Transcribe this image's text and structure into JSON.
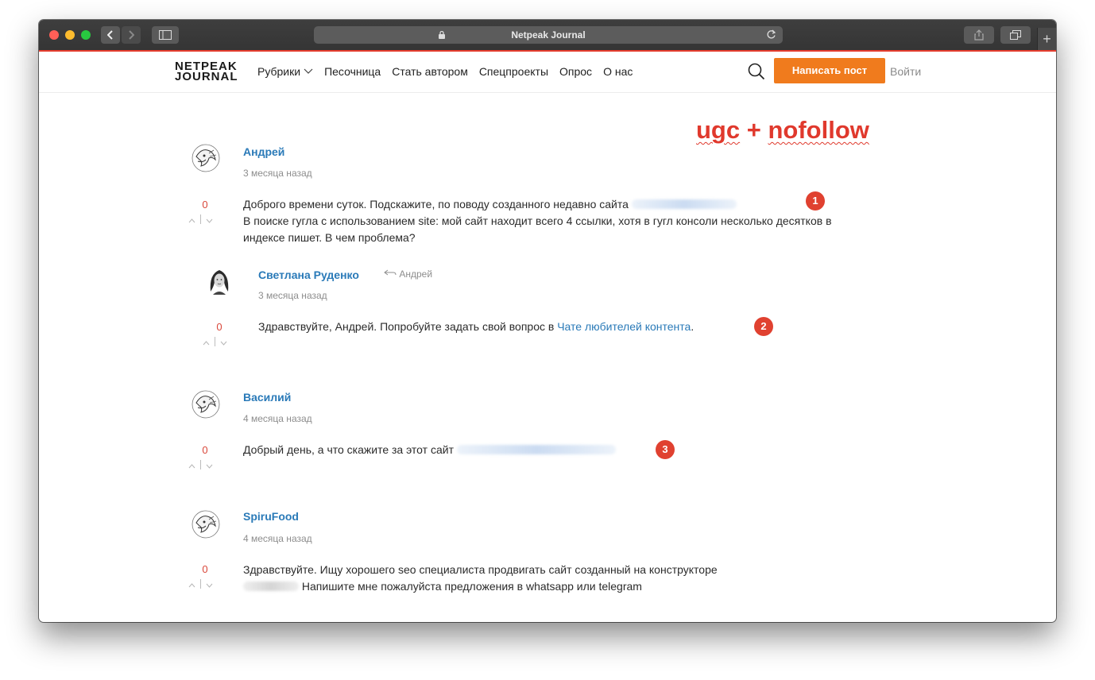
{
  "browser": {
    "title": "Netpeak Journal",
    "new_tab_symbol": "+"
  },
  "header": {
    "logo_line1": "NETPEAK",
    "logo_line2": "JOURNAL",
    "nav": [
      {
        "label": "Рубрики"
      },
      {
        "label": "Песочница"
      },
      {
        "label": "Стать автором"
      },
      {
        "label": "Спецпроекты"
      },
      {
        "label": "Опрос"
      },
      {
        "label": "О нас"
      }
    ],
    "write_post": "Написать пост",
    "login": "Войти"
  },
  "annotation": {
    "ugc": "ugc",
    "plus": " + ",
    "nofollow": "nofollow"
  },
  "comments": [
    {
      "author": "Андрей",
      "time": "3 месяца назад",
      "votes": "0",
      "text_line1": "Доброго времени суток. Подскажите, по поводу созданного недавно сайта",
      "text_line2": "В поиске гугла с использованием site: мой сайт находит всего 4 ссылки, хотя в гугл консоли несколько десятков в",
      "text_line3": "индексе пишет. В чем проблема?",
      "badge": "1"
    },
    {
      "author": "Светлана Руденко",
      "reply_to": "Андрей",
      "time": "3 месяца назад",
      "votes": "0",
      "text_before": "Здравствуйте, Андрей. Попробуйте задать свой вопрос в ",
      "link": "Чате любителей контента",
      "text_after": ".",
      "badge": "2"
    },
    {
      "author": "Василий",
      "time": "4 месяца назад",
      "votes": "0",
      "text": "Добрый день, а что скажите за этот сайт",
      "badge": "3"
    },
    {
      "author": "SpiruFood",
      "time": "4 месяца назад",
      "votes": "0",
      "text_line1": "Здравствуйте. Ищу хорошего seo специалиста продвигать сайт созданный на конструкторе",
      "text_line2": "Напишите мне пожалуйста предложения в whatsapp или telegram"
    }
  ],
  "vote_up": "^",
  "vote_down": "v",
  "colors": {
    "accent": "#f07b1d",
    "link": "#2a7ab8",
    "annotation_red": "#e0392d",
    "titlebar_accent": "#e63d2e"
  }
}
